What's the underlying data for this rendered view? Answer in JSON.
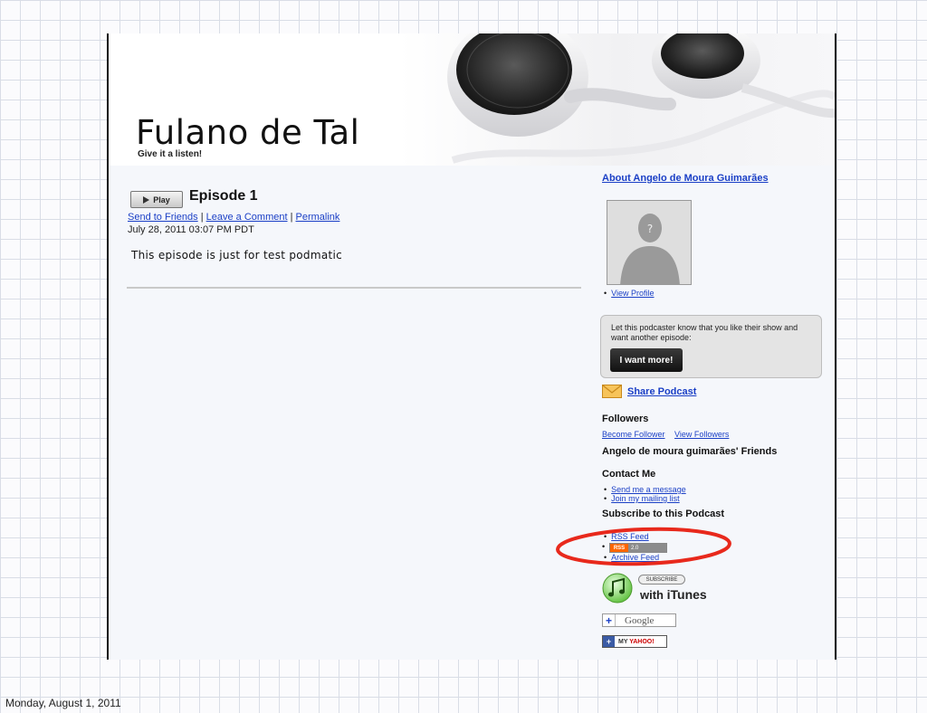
{
  "site": {
    "title": "Fulano de Tal",
    "tagline": "Give it a listen!"
  },
  "episode": {
    "play_label": "Play",
    "title": "Episode 1",
    "links": [
      "Send to Friends",
      "Leave a Comment",
      "Permalink"
    ],
    "separator": "|",
    "date": "July 28, 2011 03:07 PM PDT",
    "description": "This episode is just for test podmatic"
  },
  "sidebar": {
    "about_title": "About Angelo de Moura Guimarães",
    "view_profile": "View Profile",
    "want_more_text": "Let this podcaster know that you like their show and want another episode:",
    "want_more_button": "I want more!",
    "share_podcast": "Share Podcast",
    "followers_heading": "Followers",
    "become_follower": "Become Follower",
    "view_followers": "View Followers",
    "friends_heading": "Angelo de moura guimarães' Friends",
    "contact_heading": "Contact Me",
    "send_message": "Send me a message",
    "mailing_list": "Join my mailing list",
    "subscribe_heading": "Subscribe to this Podcast",
    "rss_feed": "RSS Feed",
    "rss_badge_left": "RSS",
    "rss_badge_right": "2.0",
    "archive_feed": "Archive Feed",
    "itunes_subscribe": "SUBSCRIBE",
    "itunes_with": "with",
    "itunes_name": "iTunes",
    "google_label": "Google",
    "yahoo_prefix": "MY",
    "yahoo_label": "YAHOO!"
  },
  "slide_footer": {
    "date": "Monday, August 1, 2011"
  },
  "colors": {
    "link": "#1a3fc6",
    "highlight_ellipse": "#e8291c",
    "rss_orange": "#ff6600"
  }
}
